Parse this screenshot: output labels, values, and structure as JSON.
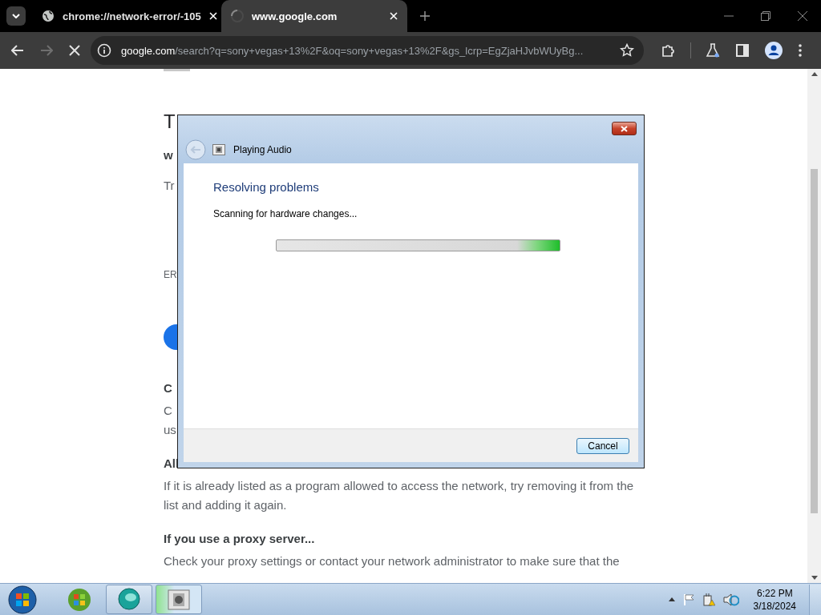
{
  "browser": {
    "tabs": [
      {
        "title": "chrome://network-error/-105",
        "selected": false,
        "loading": false
      },
      {
        "title": "www.google.com",
        "selected": true,
        "loading": true
      }
    ],
    "can_go_forward": false,
    "address": {
      "host": "google.com",
      "path": "/search?q=sony+vegas+13%2F&oq=sony+vegas+13%2F&gs_lcrp=EgZjaHJvbWUyBg..."
    }
  },
  "page": {
    "blocks": [
      {
        "kind": "title",
        "lines": [
          "T"
        ]
      },
      {
        "kind": "subtitle",
        "lines": [
          "w"
        ]
      },
      {
        "kind": "body",
        "lines": [
          "Tr"
        ]
      },
      {
        "kind": "code",
        "lines": [
          "ER"
        ]
      },
      {
        "kind": "button"
      },
      {
        "kind": "subtitle",
        "lines": [
          "C"
        ]
      },
      {
        "kind": "body",
        "lines": [
          "C",
          "us"
        ]
      },
      {
        "kind": "subtitle",
        "lines": [
          "All"
        ]
      },
      {
        "kind": "body",
        "lines": [
          "If it is already listed as a program allowed to access the network, try removing it from the list and adding it again."
        ]
      },
      {
        "kind": "subtitle",
        "lines": [
          "If you use a proxy server..."
        ]
      },
      {
        "kind": "body",
        "lines": [
          "Check your proxy settings or contact your network administrator to make sure that the"
        ]
      }
    ]
  },
  "dialog": {
    "title": "Playing Audio",
    "heading": "Resolving problems",
    "status": "Scanning for hardware changes...",
    "progress": {
      "indeterminate": true
    },
    "buttons": [
      "Cancel"
    ]
  },
  "taskbar": {
    "apps": [
      {
        "kind": "flag-orb",
        "running": false,
        "selected": false
      },
      {
        "kind": "bubble",
        "running": true,
        "selected": false
      },
      {
        "kind": "troubleshooter",
        "running": true,
        "selected": true
      }
    ],
    "clock": {
      "time": "6:22 PM",
      "date": "3/18/2024"
    }
  }
}
